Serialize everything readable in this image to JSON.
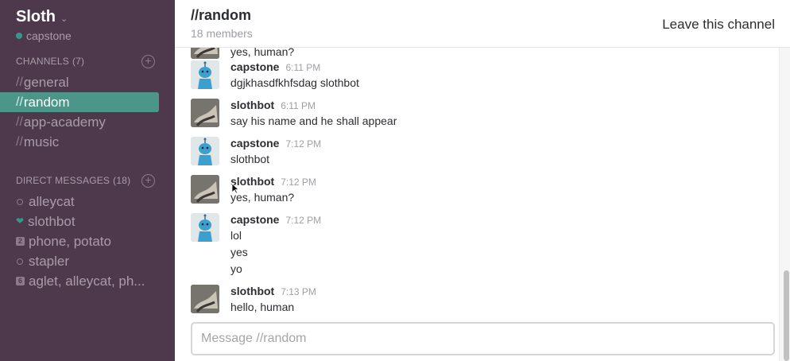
{
  "team": {
    "name": "Sloth",
    "user": "capstone"
  },
  "sidebar": {
    "channels_header": "CHANNELS",
    "channels_count": "(7)",
    "channels": [
      {
        "prefix": "//",
        "label": "general",
        "active": false
      },
      {
        "prefix": "//",
        "label": "random",
        "active": true
      },
      {
        "prefix": "//",
        "label": "app-academy",
        "active": false
      },
      {
        "prefix": "//",
        "label": "music",
        "active": false
      }
    ],
    "dm_header": "DIRECT MESSAGES",
    "dm_count": "(18)",
    "dms": [
      {
        "icon": "circle",
        "label": "alleycat"
      },
      {
        "icon": "heart",
        "label": "slothbot"
      },
      {
        "icon": "2",
        "label": "phone, potato"
      },
      {
        "icon": "circle",
        "label": "stapler"
      },
      {
        "icon": "6",
        "label": "aglet, alleycat, ph..."
      }
    ]
  },
  "header": {
    "title": "//random",
    "members": "18 members",
    "leave_label": "Leave this channel"
  },
  "messages": [
    {
      "author": "",
      "time": "",
      "lines": [
        "yes, human?"
      ],
      "avatar": "sloth",
      "partial": true
    },
    {
      "author": "capstone",
      "time": "6:11 PM",
      "lines": [
        "dgjkhasdfkhfsdag slothbot"
      ],
      "avatar": "robot"
    },
    {
      "author": "slothbot",
      "time": "6:11 PM",
      "lines": [
        "say his name and he shall appear"
      ],
      "avatar": "sloth"
    },
    {
      "author": "capstone",
      "time": "7:12 PM",
      "lines": [
        "slothbot"
      ],
      "avatar": "robot"
    },
    {
      "author": "slothbot",
      "time": "7:12 PM",
      "lines": [
        "yes, human?"
      ],
      "avatar": "sloth"
    },
    {
      "author": "capstone",
      "time": "7:12 PM",
      "lines": [
        "lol",
        "yes",
        "yo"
      ],
      "avatar": "robot"
    },
    {
      "author": "slothbot",
      "time": "7:13 PM",
      "lines": [
        "hello, human"
      ],
      "avatar": "sloth"
    }
  ],
  "composer": {
    "placeholder": "Message //random"
  },
  "colors": {
    "sidebar_bg": "#4d394b",
    "active_channel": "#4c9689",
    "presence": "#38978d"
  }
}
